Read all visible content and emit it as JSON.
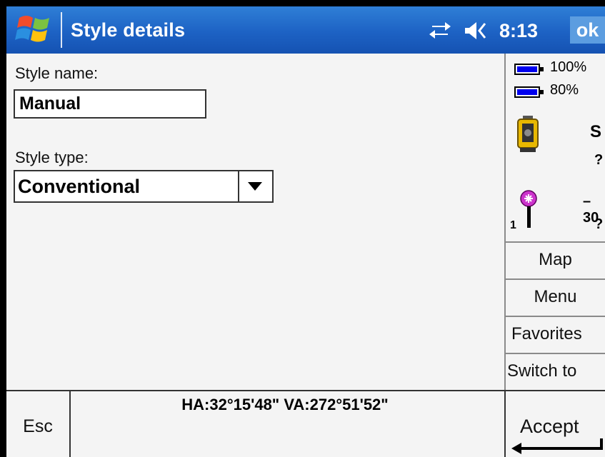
{
  "titlebar": {
    "title": "Style details",
    "time": "8:13",
    "ok_label": "ok",
    "icons": [
      "windows-start-icon",
      "sync-icon",
      "volume-icon"
    ]
  },
  "form": {
    "style_name_label": "Style name:",
    "style_name_value": "Manual",
    "style_type_label": "Style type:",
    "style_type_value": "Conventional"
  },
  "status": {
    "battery1": "100%",
    "battery2": "80%",
    "battery_color": "#0000ee",
    "instrument_letter": "S",
    "instrument_status": "?",
    "target_number": "1",
    "target_height": "–30",
    "target_status": "?"
  },
  "side_menu": {
    "map": "Map",
    "menu": "Menu",
    "favorites": "Favorites",
    "switch_to": "Switch to"
  },
  "bottombar": {
    "esc": "Esc",
    "angles": "HA:32°15'48\"  VA:272°51'52\"",
    "accept": "Accept"
  },
  "colors": {
    "titlebar": "#1d62c4",
    "ok_button": "#5c9de0",
    "background": "#f4f4f4",
    "target_icon": "#cc33cc"
  }
}
